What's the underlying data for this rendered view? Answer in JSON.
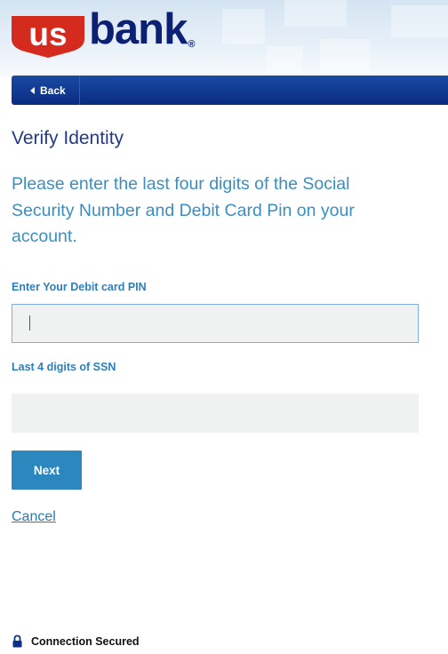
{
  "header": {
    "logo": {
      "us_text": "us",
      "bank_text": "bank",
      "registered_mark": "®",
      "shield_color": "#d52b1e",
      "bank_color": "#0c2074"
    }
  },
  "nav": {
    "back_label": "Back",
    "back_icon": "chevron-left-icon",
    "bar_color": "#0c2f87"
  },
  "page": {
    "title": "Verify Identity",
    "instructions": "Please enter the last four digits of the Social Security Number and Debit Card Pin on your account."
  },
  "form": {
    "pin": {
      "label": "Enter Your Debit card PIN",
      "value": "",
      "placeholder": ""
    },
    "ssn": {
      "label": "Last 4 digits of SSN",
      "value": "",
      "placeholder": ""
    },
    "next_label": "Next",
    "cancel_label": "Cancel"
  },
  "footer": {
    "secure_text": "Connection Secured",
    "secure_icon": "lock-icon"
  },
  "colors": {
    "title": "#233a85",
    "instructions": "#3a8fc0",
    "label": "#2e7fb8",
    "button": "#2d87bf",
    "link": "#2a7ab3",
    "input_bg": "#f0f1f1"
  }
}
